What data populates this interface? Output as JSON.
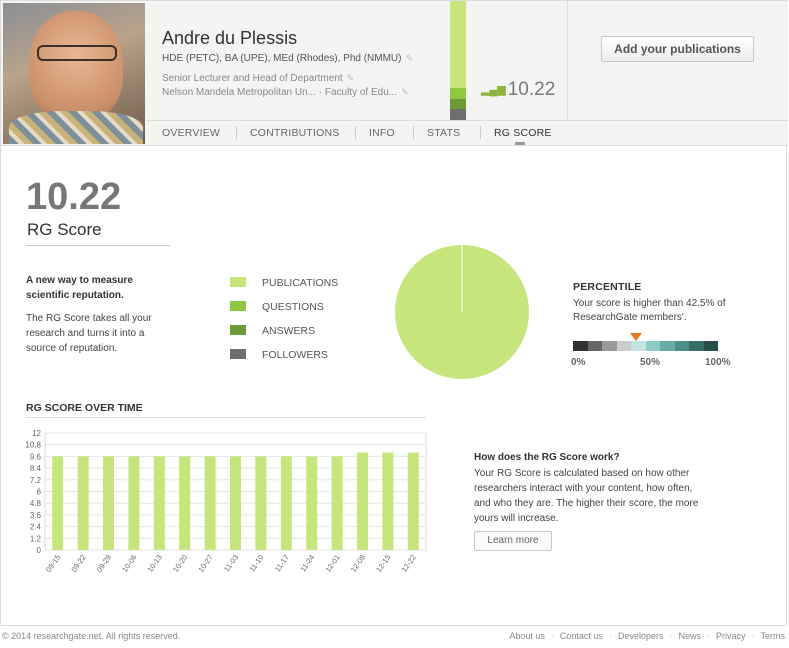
{
  "profile": {
    "name": "Andre du Plessis",
    "degrees": "HDE (PETC), BA (UPE), MEd (Rhodes), Phd (NMMU)",
    "position": "Senior Lecturer and Head of Department",
    "institution": "Nelson Mandela Metropolitan Un... · Faculty of Edu..."
  },
  "header": {
    "score": "10.22",
    "add_publications_label": "Add your publications"
  },
  "tabs": [
    {
      "label": "OVERVIEW"
    },
    {
      "label": "CONTRIBUTIONS"
    },
    {
      "label": "INFO"
    },
    {
      "label": "STATS"
    },
    {
      "label": "RG SCORE",
      "active": true
    }
  ],
  "score_summary": {
    "value": "10.22",
    "label": "RG Score",
    "intro_title": "A new way to measure scientific reputation.",
    "intro_body": "The RG Score takes all your research and turns it into a source of reputation."
  },
  "legend": [
    {
      "label": "PUBLICATIONS",
      "color": "#c6e57a"
    },
    {
      "label": "QUESTIONS",
      "color": "#8fc73e"
    },
    {
      "label": "ANSWERS",
      "color": "#6e9a35"
    },
    {
      "label": "FOLLOWERS",
      "color": "#6e6e6e"
    }
  ],
  "breakdown_pie": {
    "slices": [
      {
        "name": "PUBLICATIONS",
        "share": 1.0,
        "color": "#c6e57a"
      }
    ]
  },
  "percentile": {
    "title": "PERCENTILE",
    "text": "Your score is higher than 42.5% of ResearchGate members'.",
    "value": 42.5,
    "ticks": [
      "0%",
      "50%",
      "100%"
    ],
    "scale_colors": [
      "#333333",
      "#666666",
      "#999999",
      "#cccccc",
      "#c4e3e0",
      "#8ccac5",
      "#69aba6",
      "#4d8e89",
      "#376e69",
      "#274e4a"
    ],
    "marker_color": "#e8741e"
  },
  "chart_data": {
    "type": "bar",
    "title": "RG SCORE OVER TIME",
    "categories": [
      "09-15",
      "09-22",
      "09-29",
      "10-06",
      "10-13",
      "10-20",
      "10-27",
      "11-03",
      "11-10",
      "11-17",
      "11-24",
      "12-01",
      "12-08",
      "12-15",
      "12-22"
    ],
    "values": [
      9.6,
      9.6,
      9.6,
      9.6,
      9.6,
      9.6,
      9.6,
      9.6,
      9.6,
      9.6,
      9.6,
      9.6,
      10.0,
      10.0,
      10.0
    ],
    "y_ticks": [
      "0",
      "1.2",
      "2.4",
      "3.6",
      "4.8",
      "6",
      "7.2",
      "8.4",
      "9.6",
      "10.8",
      "12"
    ],
    "ylim": [
      0,
      12
    ],
    "grid": true,
    "bar_color": "#c6e57a"
  },
  "how_it_works": {
    "title": "How does the RG Score work?",
    "body": "Your RG Score is calculated based on how other researchers interact with your content, how often, and who they are. The higher their score, the more yours will increase.",
    "learn_more_label": "Learn more"
  },
  "footer": {
    "copyright": "© 2014 researchgate.net. All rights reserved.",
    "links": [
      "About us",
      "Contact us",
      "Developers",
      "News",
      "Privacy",
      "Terms"
    ]
  }
}
